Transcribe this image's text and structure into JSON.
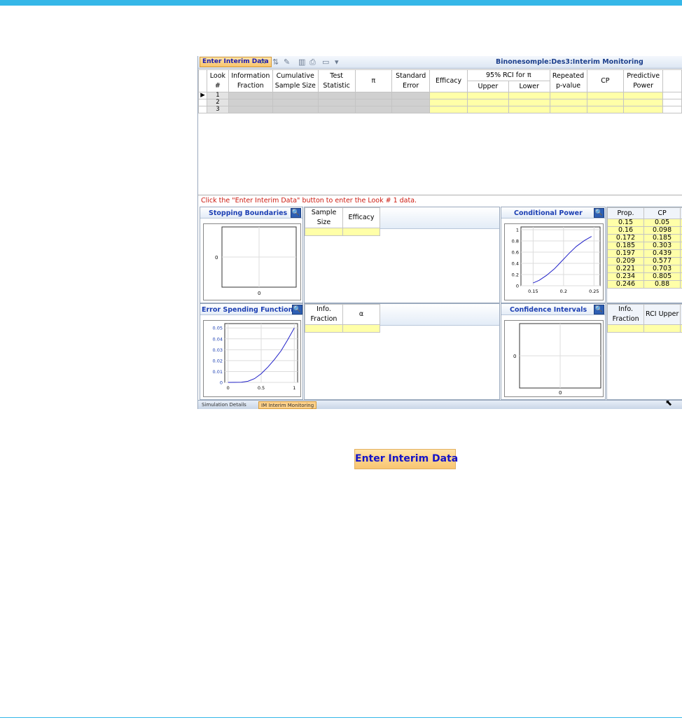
{
  "toolbar": {
    "enter_label": "Enter Interim Data",
    "title": "Binonesomple:Des3:Interim Monitoring"
  },
  "grid": {
    "headers": {
      "look": "Look #",
      "info_fraction": "Information Fraction",
      "cum_sample": "Cumulative Sample Size",
      "test_stat": "Test Statistic",
      "pi": "π",
      "std_error": "Standard Error",
      "efficacy": "Efficacy",
      "rci_group": "95% RCI for π",
      "upper": "Upper",
      "lower": "Lower",
      "repeated_p": "Repeated p-value",
      "cp": "CP",
      "predictive_power": "Predictive Power"
    },
    "rows": [
      {
        "look": "1"
      },
      {
        "look": "2"
      },
      {
        "look": "3"
      }
    ]
  },
  "message": "Click the \"Enter Interim Data\" button to enter the Look # 1 data.",
  "panels": {
    "stopping": {
      "title": "Stopping Boundaries",
      "table_headers": [
        "Sample Size",
        "Efficacy"
      ],
      "y_tick": "0",
      "x_tick": "0"
    },
    "conditional": {
      "title": "Conditional Power",
      "table_headers": [
        "Prop.",
        "CP"
      ],
      "table_rows": [
        [
          "0.15",
          "0.05"
        ],
        [
          "0.16",
          "0.098"
        ],
        [
          "0.172",
          "0.185"
        ],
        [
          "0.185",
          "0.303"
        ],
        [
          "0.197",
          "0.439"
        ],
        [
          "0.209",
          "0.577"
        ],
        [
          "0.221",
          "0.703"
        ],
        [
          "0.234",
          "0.805"
        ],
        [
          "0.246",
          "0.88"
        ]
      ],
      "y_ticks": [
        "1",
        "0.8",
        "0.6",
        "0.4",
        "0.2",
        "0"
      ],
      "x_ticks": [
        "0.15",
        "0.2",
        "0.25"
      ]
    },
    "error": {
      "title": "Error Spending Function",
      "table_headers": [
        "Info. Fraction",
        "α"
      ],
      "y_ticks": [
        "0.05",
        "0.04",
        "0.03",
        "0.02",
        "0.01",
        "0"
      ],
      "x_ticks": [
        "0",
        "0.5",
        "1"
      ]
    },
    "confidence": {
      "title": "Confidence Intervals",
      "table_headers": [
        "Info. Fraction",
        "RCI Upper"
      ],
      "y_tick": "0",
      "x_tick": "0"
    }
  },
  "tabs": {
    "sim": "Simulation Details",
    "im": "IM Interim Monitoring"
  },
  "big_button": "Enter Interim Data",
  "colors": {
    "accent_line": "#35b7e8",
    "title_blue": "#1c3fb3",
    "input_yellow": "#ffffa8",
    "message_red": "#cc1a10"
  },
  "chart_data": [
    {
      "type": "line",
      "x": [
        0.15,
        0.16,
        0.172,
        0.185,
        0.197,
        0.209,
        0.221,
        0.234,
        0.246
      ],
      "y": [
        0.05,
        0.098,
        0.185,
        0.303,
        0.439,
        0.577,
        0.703,
        0.805,
        0.88
      ],
      "xlim": [
        0.13,
        0.26
      ],
      "ylim": [
        0,
        1.05
      ],
      "grid": true
    },
    {
      "type": "line",
      "x": [
        0,
        0.2,
        0.3,
        0.4,
        0.5,
        0.6,
        0.7,
        0.8,
        0.9,
        1.0
      ],
      "y": [
        0,
        0.0002,
        0.001,
        0.0035,
        0.008,
        0.014,
        0.021,
        0.029,
        0.039,
        0.05
      ],
      "xlim": [
        -0.05,
        1.05
      ],
      "ylim": [
        0,
        0.054
      ],
      "grid": true
    }
  ]
}
